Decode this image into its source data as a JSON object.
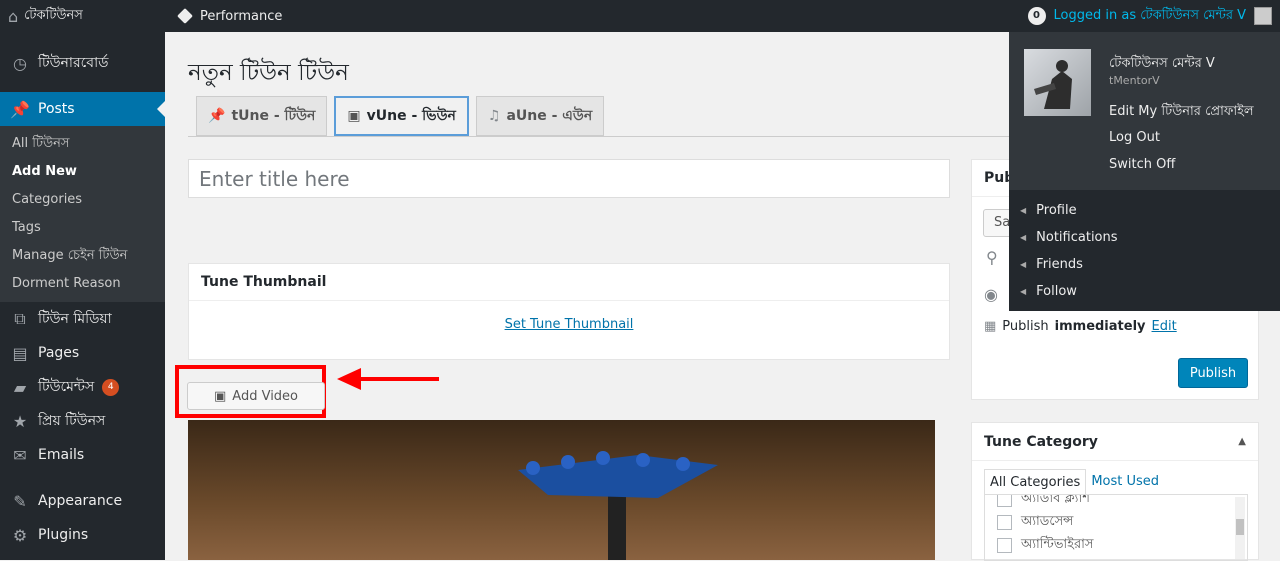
{
  "adminbar": {
    "site_name": "টেকটিউনস",
    "performance": "Performance",
    "notification_count": "0",
    "logged_in_text": "Logged in as টেকটিউনস মেন্টর V"
  },
  "sidebar": {
    "items": [
      {
        "label": "টিউনারবোর্ড",
        "icon": "dashboard-icon"
      },
      {
        "label": "Posts",
        "icon": "pushpin-icon",
        "current": true
      },
      {
        "label": "টিউন মিডিয়া",
        "icon": "media-icon"
      },
      {
        "label": "Pages",
        "icon": "page-icon"
      },
      {
        "label": "টিউমেন্টস",
        "icon": "comment-icon",
        "badge": "4"
      },
      {
        "label": "প্রিয় টিউনস",
        "icon": "star-icon"
      },
      {
        "label": "Emails",
        "icon": "email-icon"
      },
      {
        "label": "Appearance",
        "icon": "brush-icon"
      },
      {
        "label": "Plugins",
        "icon": "plugin-icon"
      }
    ],
    "submenu": [
      "All টিউনস",
      "Add New",
      "Categories",
      "Tags",
      "Manage চেইন টিউন",
      "Dorment Reason"
    ]
  },
  "main": {
    "page_title": "নতুন টিউন টিউন",
    "tabs": [
      {
        "label": "tUne - টিউন",
        "icon": "pin-icon"
      },
      {
        "label": "vUne - ভিউন",
        "icon": "video-icon",
        "active": true
      },
      {
        "label": "aUne - এউন",
        "icon": "music-icon"
      }
    ],
    "title_placeholder": "Enter title here",
    "thumbnail_box": {
      "title": "Tune Thumbnail",
      "link": "Set Tune Thumbnail"
    },
    "add_video_label": "Add Video"
  },
  "publish": {
    "title": "Pub",
    "save_label": "Sa",
    "schedule_text": "Publish",
    "schedule_value": "immediately",
    "edit_label": "Edit",
    "publish_label": "Publish"
  },
  "tune_category": {
    "title": "Tune Category",
    "tabs": [
      "All Categories",
      "Most Used"
    ],
    "items": [
      "অ্যাডাব ক্ল্যাশ",
      "অ্যাডসেন্স",
      "অ্যান্টিভাইরাস"
    ]
  },
  "dropdown": {
    "name": "টেকটিউনস মেন্টর V",
    "username": "tMentorV",
    "links": [
      "Edit My টিউনার প্রোফাইল",
      "Log Out",
      "Switch Off"
    ],
    "subitems": [
      "Profile",
      "Notifications",
      "Friends",
      "Follow"
    ]
  },
  "colors": {
    "accent": "#0073aa",
    "highlight": "#ff0000",
    "adminbar": "#23282d"
  }
}
